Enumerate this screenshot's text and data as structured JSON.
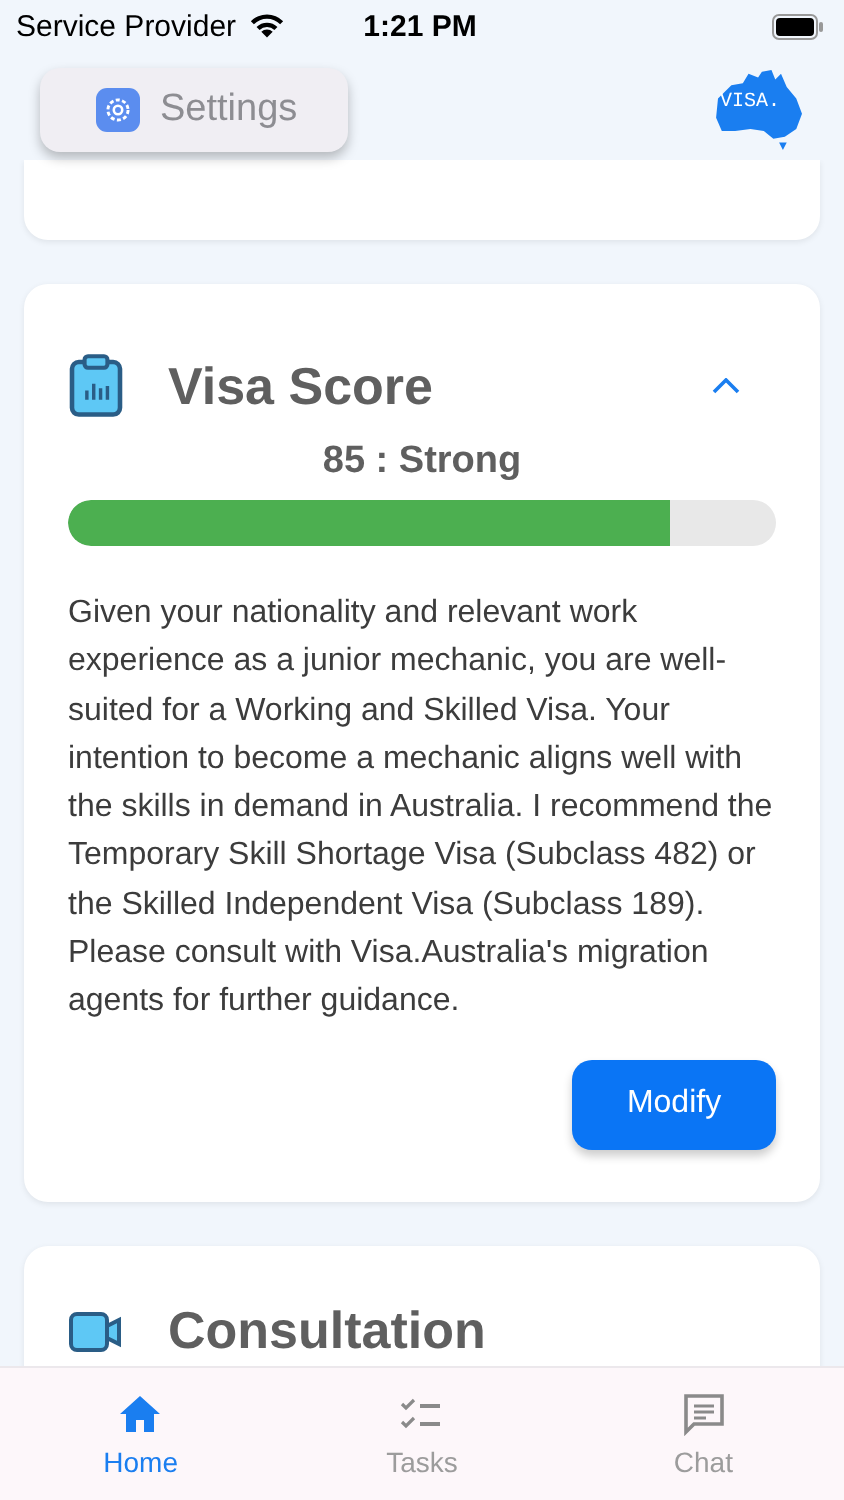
{
  "status_bar": {
    "carrier": "Service Provider",
    "time": "1:21 PM"
  },
  "header": {
    "settings_button": "Settings",
    "logo": "VISA."
  },
  "visa_score": {
    "title": "Visa Score",
    "expanded": true,
    "score": "85 : Strong",
    "level": 0.85,
    "text": "Given your nationality and relevant work experience as a junior mechanic, you are well-suited for a Working and Skilled Visa. Your intention to become a mechanic aligns well with the skills in demand in Australia. I recommend the Temporary Skill Shortage Visa (Subclass 482) or the Skilled Independent Visa (Subclass 189). Please consult with Visa.Australia's migration agents for further guidance.",
    "button": "Modify"
  },
  "consultation": {
    "title": "Consultation"
  },
  "tab_bar": [
    {
      "kind": "home",
      "label": "Home",
      "selected": true
    },
    {
      "kind": "tasks",
      "label": "Tasks",
      "selected": false
    },
    {
      "kind": "chat",
      "label": "Chat",
      "selected": false
    }
  ]
}
